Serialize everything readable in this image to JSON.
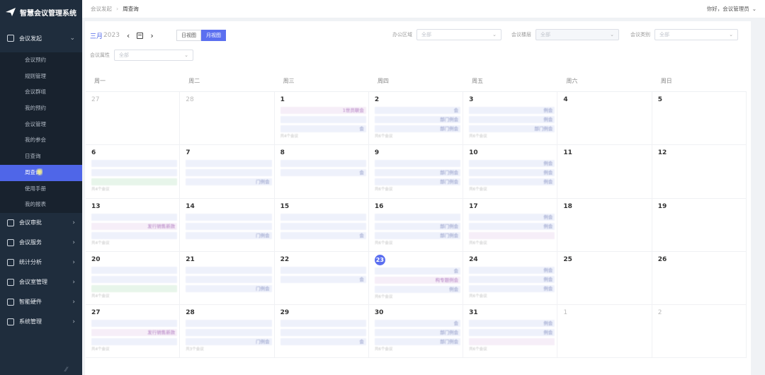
{
  "app": {
    "title": "智慧会议管理系统"
  },
  "sidebar": {
    "groups": [
      {
        "label": "会议发起",
        "icon": "document-icon",
        "expanded": true,
        "items": [
          "会议预约",
          "规则管理",
          "会议群组",
          "我的预约",
          "会议管理",
          "我的参会",
          "日查询",
          "周查询",
          "使用手册",
          "我的报表"
        ],
        "active": "周查询"
      },
      {
        "label": "会议审批",
        "icon": "approval-icon"
      },
      {
        "label": "会议服务",
        "icon": "service-icon"
      },
      {
        "label": "统计分析",
        "icon": "chart-icon"
      },
      {
        "label": "会议室管理",
        "icon": "grid-icon"
      },
      {
        "label": "智能硬件",
        "icon": "hardware-icon"
      },
      {
        "label": "系统管理",
        "icon": "settings-icon"
      }
    ]
  },
  "header": {
    "breadcrumb": [
      "会议发起",
      "周查询"
    ],
    "user_greeting": "你好，会议管理员"
  },
  "toolbar": {
    "month": "三月",
    "year": "2023",
    "views": [
      "日视图",
      "月视图"
    ],
    "active_view": "月视图"
  },
  "filters": {
    "office_area": {
      "label": "办公区域",
      "placeholder": "全部"
    },
    "building": {
      "label": "会议楼层",
      "placeholder": "全部"
    },
    "category": {
      "label": "会议类别",
      "placeholder": "全部"
    },
    "attribute": {
      "label": "会议属性",
      "placeholder": "全部"
    }
  },
  "calendar": {
    "weekdays": [
      "周一",
      "周二",
      "周三",
      "周四",
      "周五",
      "周六",
      "周日"
    ],
    "today": "23",
    "weeks": [
      [
        {
          "d": "27",
          "m": true,
          "ev": []
        },
        {
          "d": "28",
          "m": true,
          "ev": []
        },
        {
          "d": "1",
          "ev": [
            {
              "t": "1世员联会",
              "c": "pink"
            },
            {
              "t": "",
              "c": "blue"
            },
            {
              "t": "会",
              "c": "blue"
            }
          ],
          "more": "共4个会议"
        },
        {
          "d": "2",
          "ev": [
            {
              "t": "会",
              "c": "blue"
            },
            {
              "t": "部门例会",
              "c": "blue"
            },
            {
              "t": "部门例会",
              "c": "blue"
            }
          ],
          "more": "共6个会议"
        },
        {
          "d": "3",
          "ev": [
            {
              "t": "例会",
              "c": "blue"
            },
            {
              "t": "例会",
              "c": "blue"
            },
            {
              "t": "部门例会",
              "c": "blue"
            }
          ],
          "more": "共6个会议"
        },
        {
          "d": "4",
          "ev": []
        },
        {
          "d": "5",
          "ev": []
        }
      ],
      [
        {
          "d": "6",
          "ev": [
            {
              "t": "",
              "c": "blue"
            },
            {
              "t": "",
              "c": "blue"
            },
            {
              "t": "",
              "c": "green"
            }
          ],
          "more": "共4个会议"
        },
        {
          "d": "7",
          "ev": [
            {
              "t": "",
              "c": "blue"
            },
            {
              "t": "",
              "c": "blue"
            },
            {
              "t": "门例会",
              "c": "blue"
            }
          ]
        },
        {
          "d": "8",
          "ev": [
            {
              "t": "",
              "c": "blue"
            },
            {
              "t": "会",
              "c": "blue"
            }
          ]
        },
        {
          "d": "9",
          "ev": [
            {
              "t": "",
              "c": "blue"
            },
            {
              "t": "部门例会",
              "c": "blue"
            },
            {
              "t": "部门例会",
              "c": "blue"
            }
          ],
          "more": "共6个会议"
        },
        {
          "d": "10",
          "ev": [
            {
              "t": "例会",
              "c": "blue"
            },
            {
              "t": "例会",
              "c": "blue"
            },
            {
              "t": "例会",
              "c": "blue"
            }
          ],
          "more": "共6个会议"
        },
        {
          "d": "11",
          "ev": []
        },
        {
          "d": "12",
          "ev": []
        }
      ],
      [
        {
          "d": "13",
          "ev": [
            {
              "t": "",
              "c": "blue"
            },
            {
              "t": "发行销售新款",
              "c": "pink"
            },
            {
              "t": "",
              "c": "blue"
            }
          ],
          "more": "共4个会议"
        },
        {
          "d": "14",
          "ev": [
            {
              "t": "",
              "c": "blue"
            },
            {
              "t": "",
              "c": "blue"
            },
            {
              "t": "门例会",
              "c": "blue"
            }
          ]
        },
        {
          "d": "15",
          "ev": [
            {
              "t": "",
              "c": "blue"
            },
            {
              "t": "",
              "c": "blue"
            },
            {
              "t": "会",
              "c": "blue"
            }
          ]
        },
        {
          "d": "16",
          "ev": [
            {
              "t": "",
              "c": "blue"
            },
            {
              "t": "部门例会",
              "c": "blue"
            },
            {
              "t": "部门例会",
              "c": "blue"
            }
          ],
          "more": "共6个会议"
        },
        {
          "d": "17",
          "ev": [
            {
              "t": "例会",
              "c": "blue"
            },
            {
              "t": "例会",
              "c": "blue"
            },
            {
              "t": "",
              "c": "pink"
            }
          ],
          "more": "共6个会议"
        },
        {
          "d": "18",
          "ev": []
        },
        {
          "d": "19",
          "ev": []
        }
      ],
      [
        {
          "d": "20",
          "ev": [
            {
              "t": "",
              "c": "blue"
            },
            {
              "t": "",
              "c": "blue"
            },
            {
              "t": "",
              "c": "green"
            }
          ],
          "more": "共4个会议"
        },
        {
          "d": "21",
          "ev": [
            {
              "t": "",
              "c": "blue"
            },
            {
              "t": "",
              "c": "blue"
            },
            {
              "t": "门例会",
              "c": "blue"
            }
          ]
        },
        {
          "d": "22",
          "ev": [
            {
              "t": "",
              "c": "blue"
            },
            {
              "t": "会",
              "c": "blue"
            }
          ]
        },
        {
          "d": "23",
          "today": true,
          "ev": [
            {
              "t": "会",
              "c": "blue"
            },
            {
              "t": "构专题例会",
              "c": "pink"
            },
            {
              "t": "例会",
              "c": "blue"
            }
          ],
          "more": "共6个会议"
        },
        {
          "d": "24",
          "ev": [
            {
              "t": "例会",
              "c": "blue"
            },
            {
              "t": "例会",
              "c": "blue"
            },
            {
              "t": "例会",
              "c": "blue"
            }
          ],
          "more": "共6个会议"
        },
        {
          "d": "25",
          "ev": []
        },
        {
          "d": "26",
          "ev": []
        }
      ],
      [
        {
          "d": "27",
          "ev": [
            {
              "t": "",
              "c": "blue"
            },
            {
              "t": "发行销售新款",
              "c": "pink"
            },
            {
              "t": "",
              "c": "blue"
            }
          ],
          "more": "共4个会议"
        },
        {
          "d": "28",
          "ev": [
            {
              "t": "",
              "c": "blue"
            },
            {
              "t": "",
              "c": "blue"
            },
            {
              "t": "门例会",
              "c": "blue"
            }
          ],
          "more": "共3个会议"
        },
        {
          "d": "29",
          "ev": [
            {
              "t": "",
              "c": "blue"
            },
            {
              "t": "",
              "c": "blue"
            },
            {
              "t": "会",
              "c": "blue"
            }
          ]
        },
        {
          "d": "30",
          "ev": [
            {
              "t": "会",
              "c": "blue"
            },
            {
              "t": "部门例会",
              "c": "blue"
            },
            {
              "t": "部门例会",
              "c": "blue"
            }
          ],
          "more": "共6个会议"
        },
        {
          "d": "31",
          "ev": [
            {
              "t": "例会",
              "c": "blue"
            },
            {
              "t": "例会",
              "c": "blue"
            },
            {
              "t": "",
              "c": "pink"
            }
          ],
          "more": "共6个会议"
        },
        {
          "d": "1",
          "m": true,
          "ev": []
        },
        {
          "d": "2",
          "m": true,
          "ev": []
        }
      ]
    ]
  },
  "colors": {
    "accent": "#4f66e8",
    "sidebar_bg": "#1f2d3d"
  }
}
